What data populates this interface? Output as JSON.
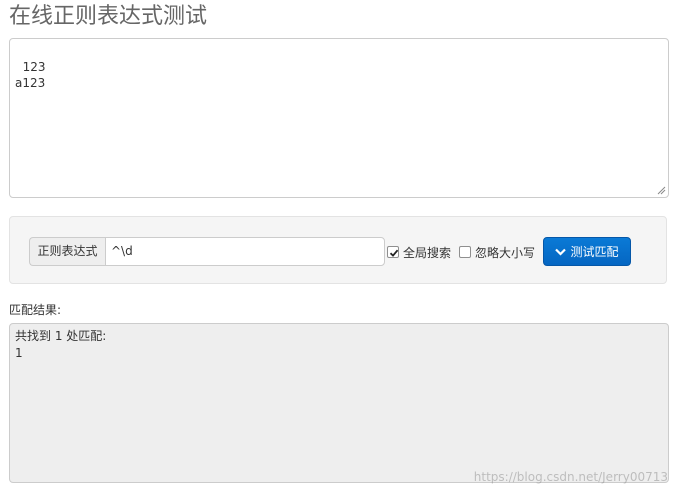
{
  "page": {
    "title": "在线正则表达式测试"
  },
  "source": {
    "text": "123\na123"
  },
  "controls": {
    "regex_label": "正则表达式",
    "regex_value": "^\\d",
    "global_search_label": "全局搜索",
    "global_search_checked": true,
    "ignore_case_label": "忽略大小写",
    "ignore_case_checked": false,
    "test_button_label": "测试匹配",
    "button_color": "#0a72cc"
  },
  "result": {
    "label": "匹配结果:",
    "text": "共找到 1 处匹配:\n1"
  },
  "watermark": "https://blog.csdn.net/Jerry00713"
}
